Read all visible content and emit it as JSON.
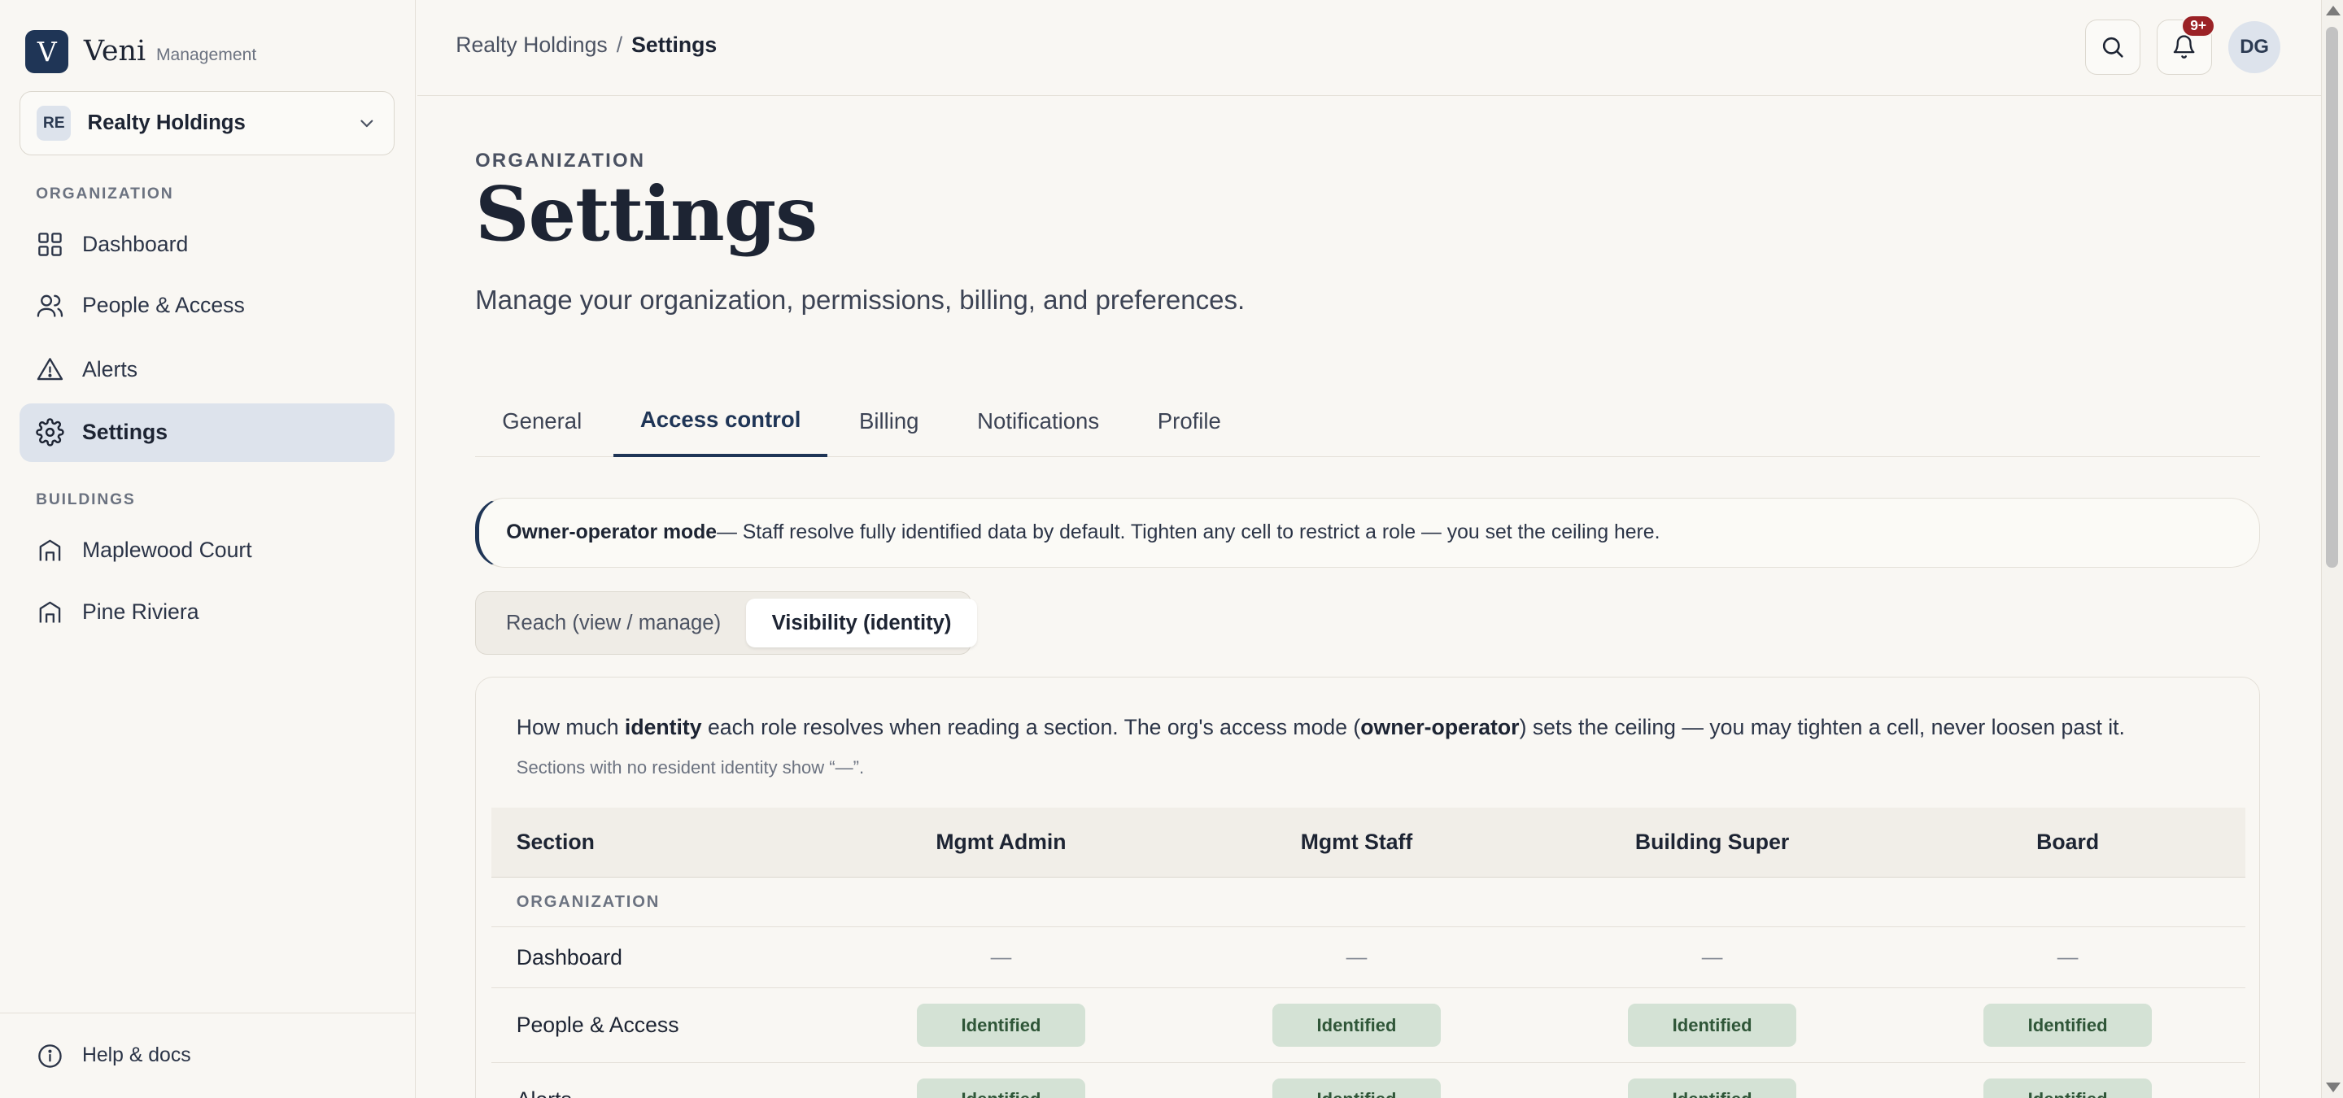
{
  "brand": {
    "logo_letter": "V",
    "name": "Veni",
    "sub": "Management"
  },
  "org_switcher": {
    "badge": "RE",
    "name": "Realty Holdings"
  },
  "sidebar": {
    "section_org": "ORGANIZATION",
    "org_items": [
      {
        "label": "Dashboard",
        "icon": "grid-icon"
      },
      {
        "label": "People & Access",
        "icon": "users-icon"
      },
      {
        "label": "Alerts",
        "icon": "alert-triangle-icon"
      },
      {
        "label": "Settings",
        "icon": "gear-icon",
        "active": true
      }
    ],
    "section_buildings": "BUILDINGS",
    "building_items": [
      {
        "label": "Maplewood Court",
        "icon": "building-icon"
      },
      {
        "label": "Pine Riviera",
        "icon": "building-icon"
      }
    ],
    "footer_label": "Help & docs"
  },
  "topbar": {
    "breadcrumb_parent": "Realty Holdings",
    "breadcrumb_sep": "/",
    "breadcrumb_current": "Settings",
    "notif_count": "9+",
    "avatar_initials": "DG"
  },
  "page": {
    "kicker": "ORGANIZATION",
    "title": "Settings",
    "subtitle": "Manage your organization, permissions, billing, and preferences."
  },
  "tabs": [
    {
      "label": "General"
    },
    {
      "label": "Access control",
      "active": true
    },
    {
      "label": "Billing"
    },
    {
      "label": "Notifications"
    },
    {
      "label": "Profile"
    }
  ],
  "callout": {
    "bold": "Owner-operator mode",
    "text": " — Staff resolve fully identified data by default. Tighten any cell to restrict a role — you set the ceiling here."
  },
  "segmented": {
    "reach": "Reach (view / manage)",
    "visibility": "Visibility (identity)"
  },
  "panel": {
    "desc_1": "How much ",
    "desc_bold_1": "identity",
    "desc_2": " each role resolves when reading a section. The org's access mode (",
    "desc_bold_2": "owner-operator",
    "desc_3": ") sets the ceiling — you may tighten a cell, never loosen past it.",
    "note": "Sections with no resident identity show “—”."
  },
  "grid": {
    "headers": {
      "section": "Section",
      "roles": [
        "Mgmt Admin",
        "Mgmt Staff",
        "Building Super",
        "Board"
      ]
    },
    "group": "ORGANIZATION",
    "rows": [
      {
        "section": "Dashboard",
        "cells": [
          "—",
          "—",
          "—",
          "—"
        ]
      },
      {
        "section": "People & Access",
        "cells": [
          "Identified",
          "Identified",
          "Identified",
          "Identified"
        ]
      },
      {
        "section": "Alerts",
        "cells": [
          "Identified",
          "Identified",
          "Identified",
          "Identified"
        ]
      }
    ]
  },
  "colors": {
    "accent": "#1f3556",
    "pill_bg": "#d4e2d5",
    "pill_text": "#2f5638",
    "badge_red": "#9b2226"
  }
}
